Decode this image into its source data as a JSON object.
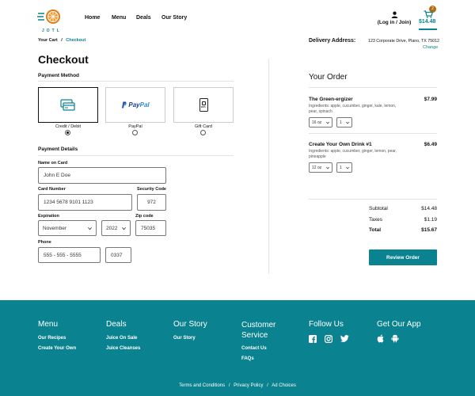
{
  "header": {
    "logo_text": "JOTL",
    "nav": [
      "Home",
      "Menu",
      "Deals",
      "Our Story"
    ],
    "account_label": "(Log in / Join)",
    "cart_count": "2",
    "cart_total": "$14.48"
  },
  "breadcrumb": {
    "first": "Your Cart",
    "sep": "/",
    "current": "Checkout"
  },
  "delivery": {
    "label": "Delivery Address:",
    "address": "123 Corporate Drive, Plano, TX 75012",
    "change": "Change"
  },
  "checkout": {
    "title": "Checkout",
    "payment_method_heading": "Payment Method",
    "methods": [
      {
        "label": "Credit / Debit",
        "icon": "credit-card-icon",
        "selected": true
      },
      {
        "label": "PayPal",
        "icon": "paypal-logo",
        "selected": false
      },
      {
        "label": "Gift Card",
        "icon": "gift-card-icon",
        "selected": false
      }
    ],
    "paypal_logo_a": "Pay",
    "paypal_logo_b": "Pal",
    "gift_card_mark": "JOTL",
    "payment_details_heading": "Payment Details",
    "name_label": "Name on Card",
    "name_value": "John E Doe",
    "card_label": "Card Number",
    "card_value": "1234 5678 9101 1123",
    "security_label": "Security Code",
    "security_value": "972",
    "expiration_label": "Expiration",
    "exp_month": "November",
    "exp_year": "2022",
    "zip_label": "Zip code",
    "zip_value": "75035",
    "phone_label": "Phone",
    "phone_value": "555 - 555 - 5555",
    "phone_ext": "0337"
  },
  "order": {
    "title": "Your Order",
    "items": [
      {
        "name": "The Green-ergizer",
        "price": "$7.99",
        "ingredients": "Ingredients: apple, cucumber, ginger, kale, lemon, pear, spinach",
        "size": "16 oz",
        "qty": "1"
      },
      {
        "name": "Create Your Own Drink #1",
        "price": "$6.49",
        "ingredients": "Ingredients: apple, cucumber, ginger, lemon, pear, pineapple",
        "size": "12 oz",
        "qty": "1"
      }
    ],
    "subtotal_label": "Subtotal",
    "subtotal": "$14.48",
    "taxes_label": "Taxes",
    "taxes": "$1.19",
    "total_label": "Total",
    "total": "$15.67",
    "review_button": "Review Order"
  },
  "footer": {
    "menu": {
      "title": "Menu",
      "links": [
        "Our Recipes",
        "Create Your Own"
      ]
    },
    "deals": {
      "title": "Deals",
      "links": [
        "Juice On Sale",
        "Juice Cleanses"
      ]
    },
    "story": {
      "title": "Our Story",
      "links": [
        "Our Story"
      ]
    },
    "service": {
      "title": "Customer Service",
      "links": [
        "Contact Us",
        "FAQs"
      ]
    },
    "follow": {
      "title": "Follow Us",
      "icons": [
        "facebook-icon",
        "instagram-icon",
        "twitter-icon"
      ]
    },
    "app": {
      "title": "Get Our App",
      "icons": [
        "apple-icon",
        "android-icon"
      ]
    },
    "legal": [
      "Terms and Conditions",
      "Privacy Policy",
      "Ad Choices"
    ],
    "legal_sep": "/"
  },
  "colors": {
    "teal": "#0a8290",
    "orange": "#e07b17"
  }
}
